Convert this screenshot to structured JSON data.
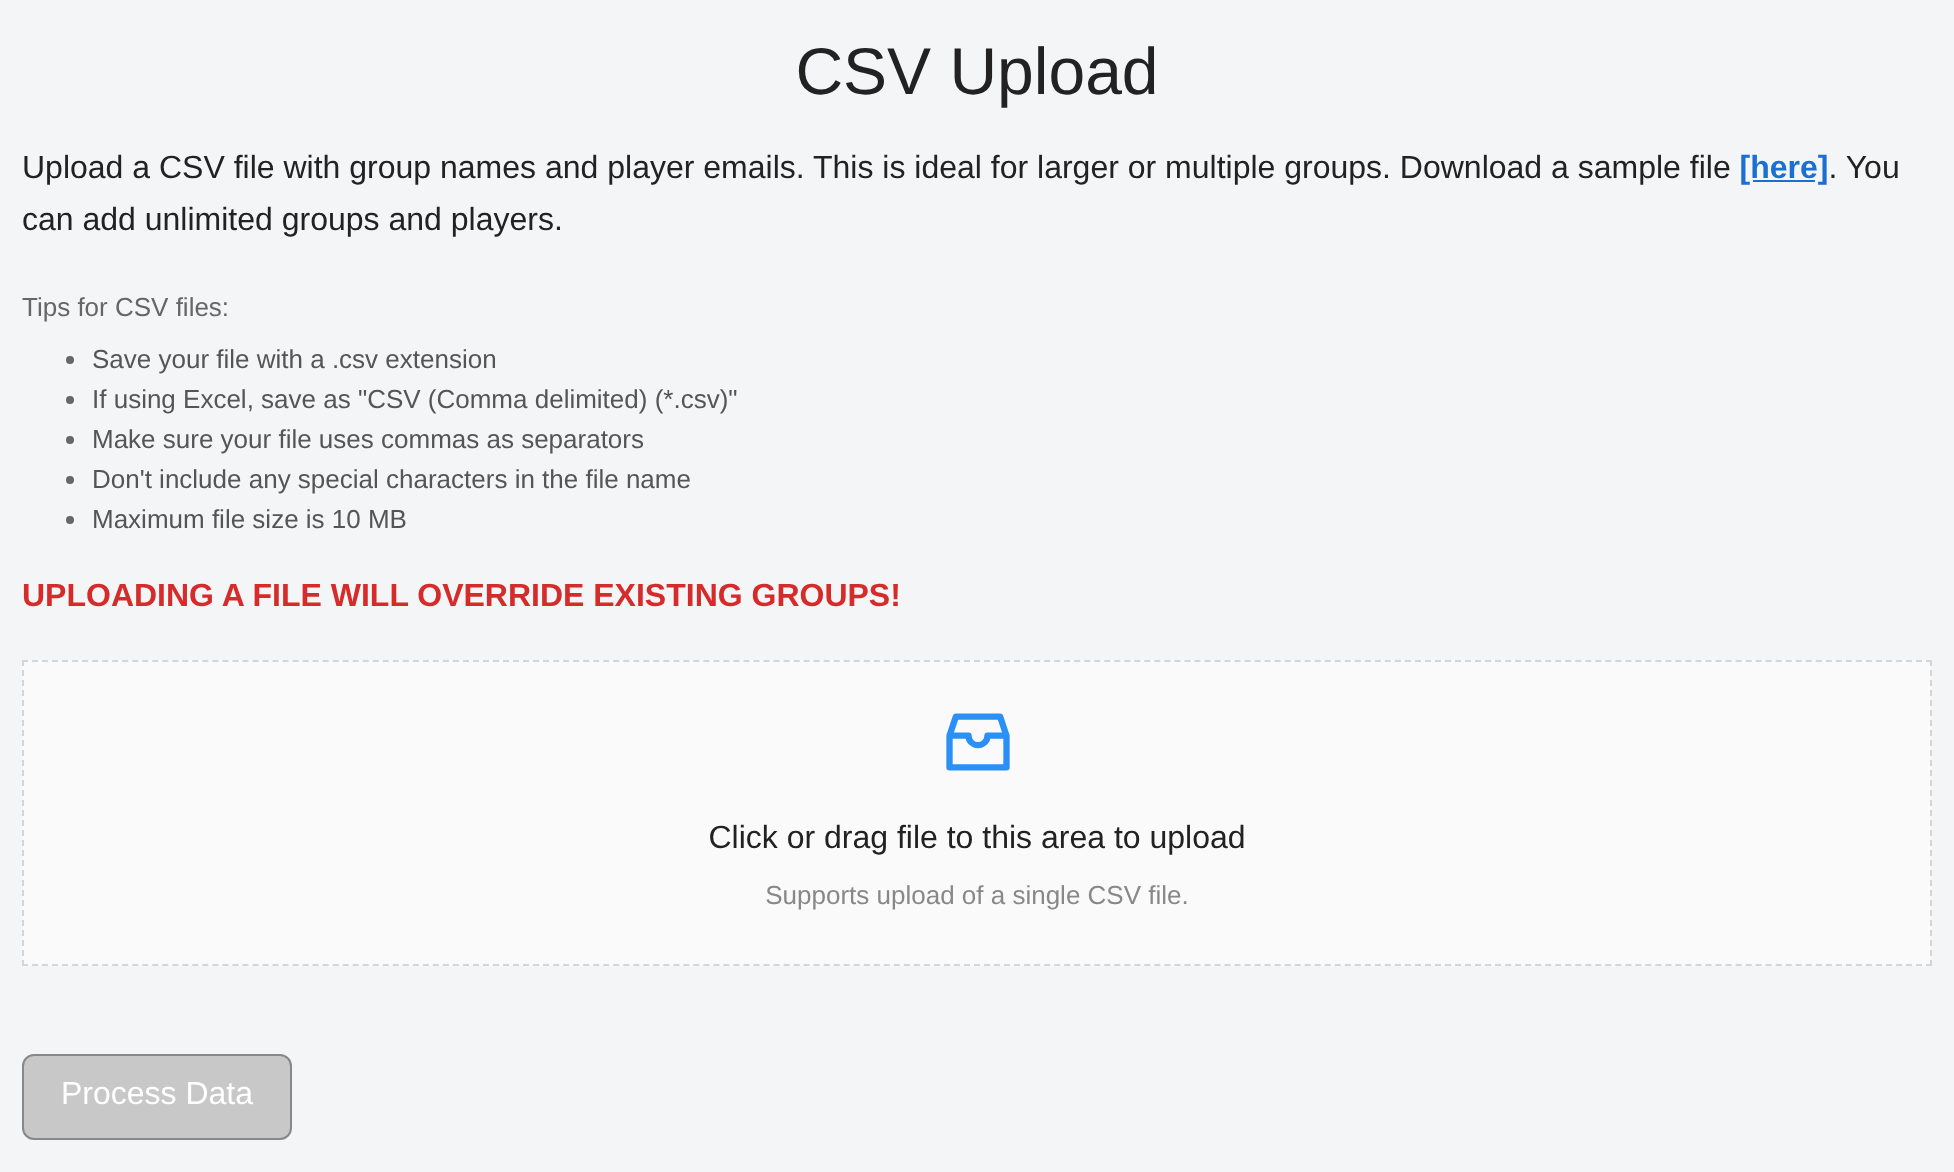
{
  "title": "CSV Upload",
  "intro": {
    "before": "Upload a CSV file with group names and player emails. This is ideal for larger or multiple groups. Download a sample file ",
    "link": "[here]",
    "after": ". You can add unlimited groups and players."
  },
  "tips": {
    "heading": "Tips for CSV files:",
    "items": [
      "Save your file with a .csv extension",
      "If using Excel, save as \"CSV (Comma delimited) (*.csv)\"",
      "Make sure your file uses commas as separators",
      "Don't include any special characters in the file name",
      "Maximum file size is 10 MB"
    ]
  },
  "warning": "UPLOADING A FILE WILL OVERRIDE EXISTING GROUPS!",
  "dropzone": {
    "text": "Click or drag file to this area to upload",
    "hint": "Supports upload of a single CSV file."
  },
  "button": {
    "label": "Process Data",
    "disabled": true
  }
}
